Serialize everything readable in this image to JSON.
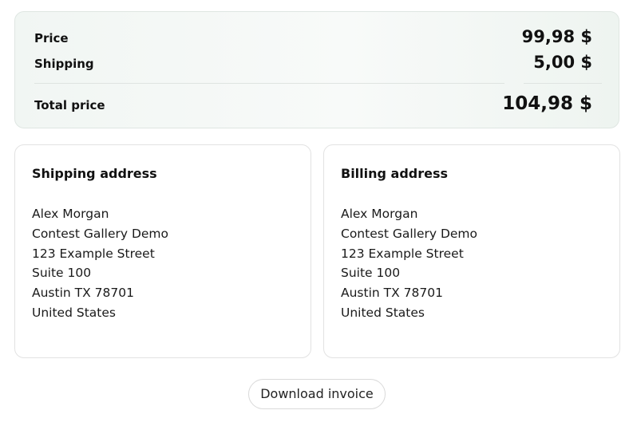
{
  "summary": {
    "price_label": "Price",
    "price_value": "99,98 $",
    "shipping_label": "Shipping",
    "shipping_value": "5,00 $",
    "total_label": "Total price",
    "total_value": "104,98 $"
  },
  "shipping_address": {
    "title": "Shipping address",
    "lines": [
      "Alex Morgan",
      "Contest Gallery Demo",
      "123 Example Street",
      "Suite 100",
      "Austin TX 78701",
      "United States"
    ]
  },
  "billing_address": {
    "title": "Billing address",
    "lines": [
      "Alex Morgan",
      "Contest Gallery Demo",
      "123 Example Street",
      "Suite 100",
      "Austin TX 78701",
      "United States"
    ]
  },
  "actions": {
    "download_invoice_label": "Download invoice"
  }
}
